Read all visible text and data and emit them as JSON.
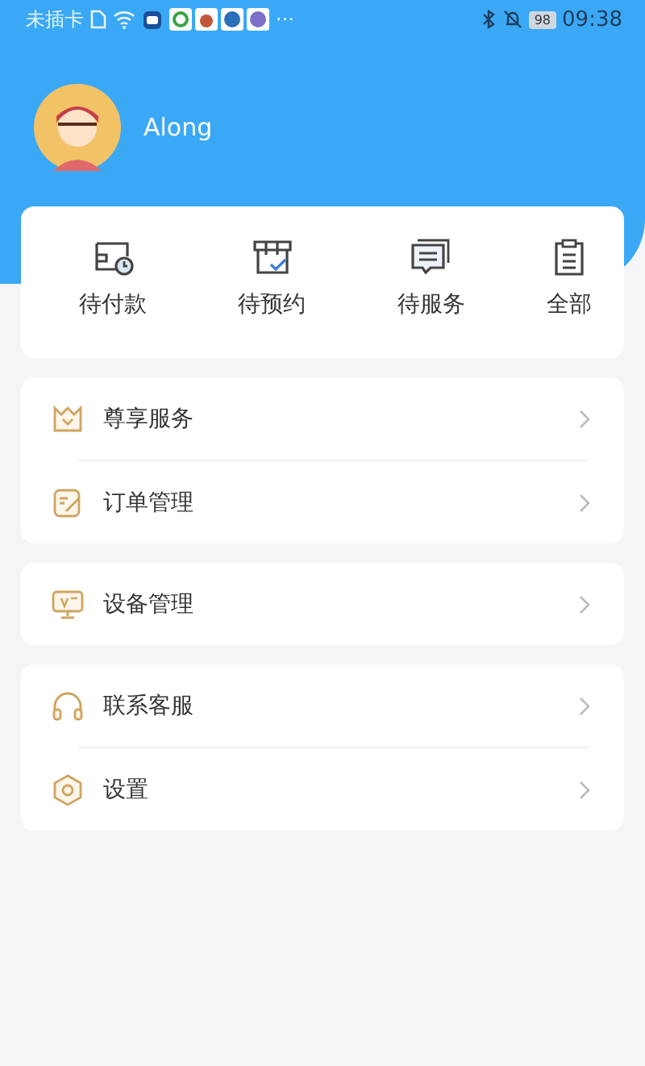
{
  "status_bar": {
    "carrier": "未插卡",
    "more": "···",
    "battery": "98",
    "time": "09:38"
  },
  "profile": {
    "name": "Along"
  },
  "orders": [
    {
      "label": "待付款"
    },
    {
      "label": "待预约"
    },
    {
      "label": "待服务"
    },
    {
      "label": "全部"
    }
  ],
  "menu_groups": [
    [
      {
        "label": "尊享服务"
      },
      {
        "label": "订单管理"
      }
    ],
    [
      {
        "label": "设备管理"
      }
    ],
    [
      {
        "label": "联系客服"
      },
      {
        "label": "设置"
      }
    ]
  ]
}
